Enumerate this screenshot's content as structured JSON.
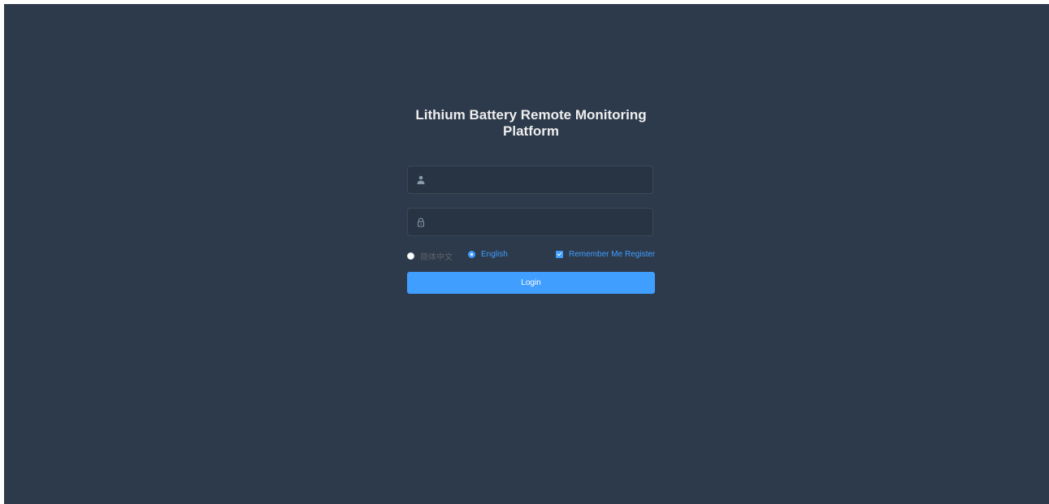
{
  "title": "Lithium Battery Remote Monitoring Platform",
  "username": {
    "icon": "user-icon",
    "value": "",
    "placeholder": ""
  },
  "password": {
    "icon": "lock-icon",
    "value": "",
    "placeholder": ""
  },
  "language": {
    "options": [
      "简体中文",
      "English"
    ],
    "selected": "English"
  },
  "remember_me": {
    "label": "Remember Me",
    "checked": true
  },
  "register_label": "Register",
  "login_label": "Login",
  "colors": {
    "background": "#2d3a4b",
    "input_background": "#283443",
    "accent": "#409eff",
    "title": "#eeeeee"
  }
}
